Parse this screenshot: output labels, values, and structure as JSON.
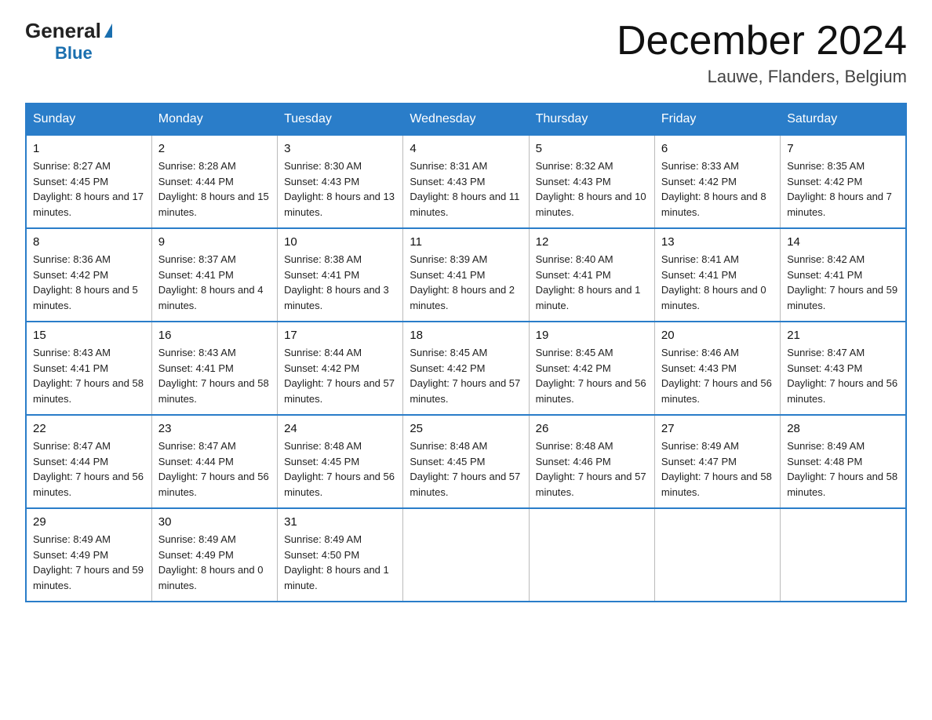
{
  "logo": {
    "general": "General",
    "blue": "Blue"
  },
  "header": {
    "month": "December 2024",
    "location": "Lauwe, Flanders, Belgium"
  },
  "weekdays": [
    "Sunday",
    "Monday",
    "Tuesday",
    "Wednesday",
    "Thursday",
    "Friday",
    "Saturday"
  ],
  "weeks": [
    [
      {
        "day": "1",
        "sunrise": "8:27 AM",
        "sunset": "4:45 PM",
        "daylight": "8 hours and 17 minutes."
      },
      {
        "day": "2",
        "sunrise": "8:28 AM",
        "sunset": "4:44 PM",
        "daylight": "8 hours and 15 minutes."
      },
      {
        "day": "3",
        "sunrise": "8:30 AM",
        "sunset": "4:43 PM",
        "daylight": "8 hours and 13 minutes."
      },
      {
        "day": "4",
        "sunrise": "8:31 AM",
        "sunset": "4:43 PM",
        "daylight": "8 hours and 11 minutes."
      },
      {
        "day": "5",
        "sunrise": "8:32 AM",
        "sunset": "4:43 PM",
        "daylight": "8 hours and 10 minutes."
      },
      {
        "day": "6",
        "sunrise": "8:33 AM",
        "sunset": "4:42 PM",
        "daylight": "8 hours and 8 minutes."
      },
      {
        "day": "7",
        "sunrise": "8:35 AM",
        "sunset": "4:42 PM",
        "daylight": "8 hours and 7 minutes."
      }
    ],
    [
      {
        "day": "8",
        "sunrise": "8:36 AM",
        "sunset": "4:42 PM",
        "daylight": "8 hours and 5 minutes."
      },
      {
        "day": "9",
        "sunrise": "8:37 AM",
        "sunset": "4:41 PM",
        "daylight": "8 hours and 4 minutes."
      },
      {
        "day": "10",
        "sunrise": "8:38 AM",
        "sunset": "4:41 PM",
        "daylight": "8 hours and 3 minutes."
      },
      {
        "day": "11",
        "sunrise": "8:39 AM",
        "sunset": "4:41 PM",
        "daylight": "8 hours and 2 minutes."
      },
      {
        "day": "12",
        "sunrise": "8:40 AM",
        "sunset": "4:41 PM",
        "daylight": "8 hours and 1 minute."
      },
      {
        "day": "13",
        "sunrise": "8:41 AM",
        "sunset": "4:41 PM",
        "daylight": "8 hours and 0 minutes."
      },
      {
        "day": "14",
        "sunrise": "8:42 AM",
        "sunset": "4:41 PM",
        "daylight": "7 hours and 59 minutes."
      }
    ],
    [
      {
        "day": "15",
        "sunrise": "8:43 AM",
        "sunset": "4:41 PM",
        "daylight": "7 hours and 58 minutes."
      },
      {
        "day": "16",
        "sunrise": "8:43 AM",
        "sunset": "4:41 PM",
        "daylight": "7 hours and 58 minutes."
      },
      {
        "day": "17",
        "sunrise": "8:44 AM",
        "sunset": "4:42 PM",
        "daylight": "7 hours and 57 minutes."
      },
      {
        "day": "18",
        "sunrise": "8:45 AM",
        "sunset": "4:42 PM",
        "daylight": "7 hours and 57 minutes."
      },
      {
        "day": "19",
        "sunrise": "8:45 AM",
        "sunset": "4:42 PM",
        "daylight": "7 hours and 56 minutes."
      },
      {
        "day": "20",
        "sunrise": "8:46 AM",
        "sunset": "4:43 PM",
        "daylight": "7 hours and 56 minutes."
      },
      {
        "day": "21",
        "sunrise": "8:47 AM",
        "sunset": "4:43 PM",
        "daylight": "7 hours and 56 minutes."
      }
    ],
    [
      {
        "day": "22",
        "sunrise": "8:47 AM",
        "sunset": "4:44 PM",
        "daylight": "7 hours and 56 minutes."
      },
      {
        "day": "23",
        "sunrise": "8:47 AM",
        "sunset": "4:44 PM",
        "daylight": "7 hours and 56 minutes."
      },
      {
        "day": "24",
        "sunrise": "8:48 AM",
        "sunset": "4:45 PM",
        "daylight": "7 hours and 56 minutes."
      },
      {
        "day": "25",
        "sunrise": "8:48 AM",
        "sunset": "4:45 PM",
        "daylight": "7 hours and 57 minutes."
      },
      {
        "day": "26",
        "sunrise": "8:48 AM",
        "sunset": "4:46 PM",
        "daylight": "7 hours and 57 minutes."
      },
      {
        "day": "27",
        "sunrise": "8:49 AM",
        "sunset": "4:47 PM",
        "daylight": "7 hours and 58 minutes."
      },
      {
        "day": "28",
        "sunrise": "8:49 AM",
        "sunset": "4:48 PM",
        "daylight": "7 hours and 58 minutes."
      }
    ],
    [
      {
        "day": "29",
        "sunrise": "8:49 AM",
        "sunset": "4:49 PM",
        "daylight": "7 hours and 59 minutes."
      },
      {
        "day": "30",
        "sunrise": "8:49 AM",
        "sunset": "4:49 PM",
        "daylight": "8 hours and 0 minutes."
      },
      {
        "day": "31",
        "sunrise": "8:49 AM",
        "sunset": "4:50 PM",
        "daylight": "8 hours and 1 minute."
      },
      null,
      null,
      null,
      null
    ]
  ],
  "labels": {
    "sunrise": "Sunrise:",
    "sunset": "Sunset:",
    "daylight": "Daylight:"
  }
}
